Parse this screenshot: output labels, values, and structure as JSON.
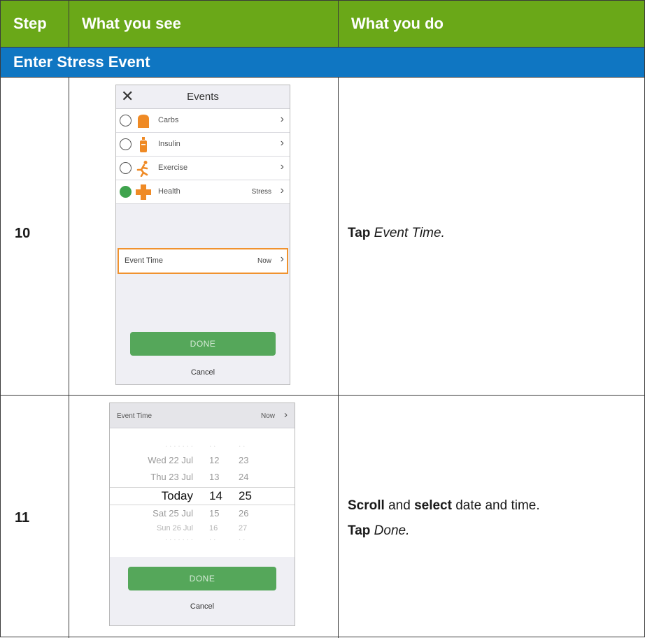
{
  "table": {
    "headers": [
      "Step",
      "What you see",
      "What you do"
    ],
    "section": "Enter Stress Event",
    "rows": [
      {
        "step": "10",
        "instruction": {
          "verb": "Tap",
          "target": "Event Time."
        }
      },
      {
        "step": "11",
        "instruction": {
          "line1_verb1": "Scroll",
          "line1_and": "and",
          "line1_verb2": "select",
          "line1_rest": "date and time.",
          "line2_verb": "Tap",
          "line2_target": "Done."
        }
      }
    ]
  },
  "screen1": {
    "title": "Events",
    "close_icon": "close-x",
    "events": [
      {
        "label": "Carbs",
        "value": "",
        "icon": "carbs-icon",
        "selected": false
      },
      {
        "label": "Insulin",
        "value": "",
        "icon": "insulin-icon",
        "selected": false
      },
      {
        "label": "Exercise",
        "value": "",
        "icon": "exercise-icon",
        "selected": false
      },
      {
        "label": "Health",
        "value": "Stress",
        "icon": "health-icon",
        "selected": true
      }
    ],
    "event_time_label": "Event Time",
    "event_time_value": "Now",
    "done_label": "DONE",
    "cancel_label": "Cancel"
  },
  "screen2": {
    "event_time_label": "Event Time",
    "event_time_value": "Now",
    "picker": {
      "rows": [
        {
          "date": "Wed 22 Jul",
          "hour": "12",
          "minute": "23"
        },
        {
          "date": "Thu 23 Jul",
          "hour": "13",
          "minute": "24"
        },
        {
          "date": "Today",
          "hour": "14",
          "minute": "25"
        },
        {
          "date": "Sat 25 Jul",
          "hour": "15",
          "minute": "26"
        },
        {
          "date": "Sun 26 Jul",
          "hour": "16",
          "minute": "27"
        }
      ]
    },
    "done_label": "DONE",
    "cancel_label": "Cancel"
  },
  "colors": {
    "header_green": "#6aa818",
    "section_blue": "#0f76c2",
    "highlight_orange": "#f0922e",
    "done_green": "#55a75a",
    "icon_orange": "#ef8a25"
  }
}
